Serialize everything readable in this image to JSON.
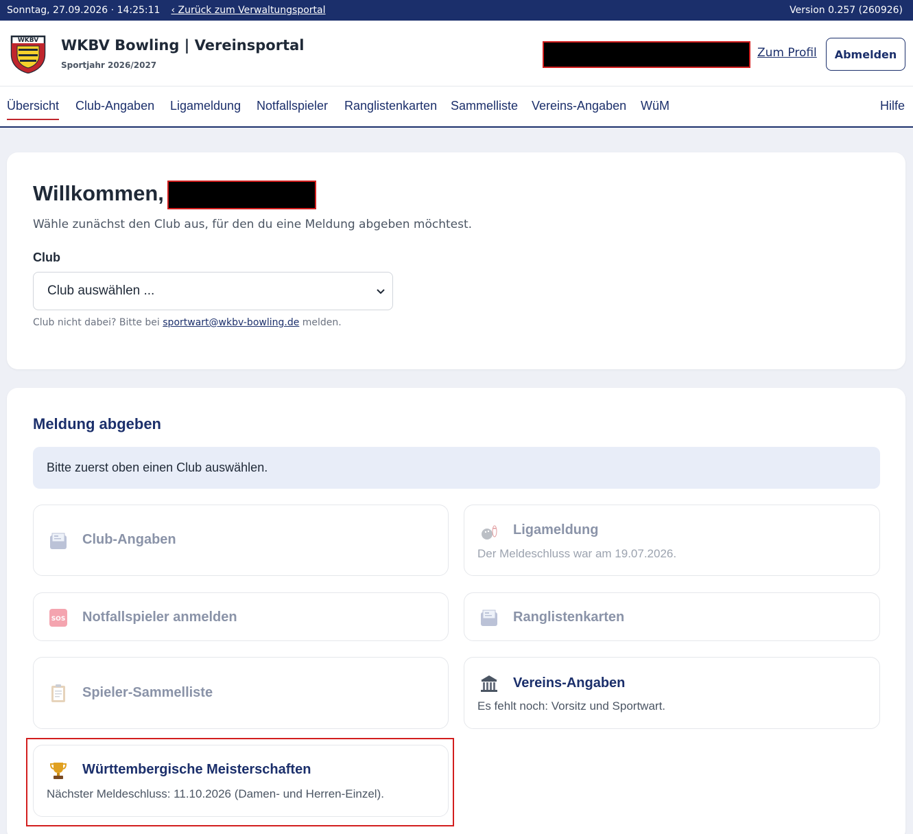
{
  "topbar": {
    "datetime": "Sonntag, 27.09.2026 · 14:25:11",
    "back_link": "‹ Zurück zum Verwaltungsportal",
    "version": "Version 0.257 (260926)"
  },
  "header": {
    "logo_text": "WKBV",
    "title": "WKBV Bowling | Vereinsportal",
    "subtitle": "Sportjahr 2026/2027",
    "profile_link": "Zum Profil",
    "logout_label": "Abmelden"
  },
  "nav": {
    "items": [
      {
        "label": "Übersicht",
        "active": true
      },
      {
        "label": "Club-Angaben"
      },
      {
        "label": "Ligameldung"
      },
      {
        "label": "Notfallspieler"
      },
      {
        "label": "Ranglistenkarten"
      },
      {
        "label": "Sammelliste"
      },
      {
        "label": "Vereins-Angaben"
      },
      {
        "label": "WüM"
      }
    ],
    "help": "Hilfe"
  },
  "welcome": {
    "title": "Willkommen,",
    "subtitle": "Wähle zunächst den Club aus, für den du eine Meldung abgeben möchtest.",
    "club_label": "Club",
    "club_select_value": "Club auswählen ...",
    "hint_before": "Club nicht dabei? Bitte bei ",
    "hint_email": "sportwart@wkbv-bowling.de",
    "hint_after": " melden."
  },
  "meldung": {
    "title": "Meldung abgeben",
    "info": "Bitte zuerst oben einen Club auswählen.",
    "tiles": [
      {
        "title": "Club-Angaben",
        "desc": "",
        "icon": "calendar-icon",
        "state": "disabled"
      },
      {
        "title": "Ligameldung",
        "desc": "Der Meldeschluss war am 19.07.2026.",
        "icon": "bowling-icon",
        "state": "disabled"
      },
      {
        "title": "Notfallspieler anmelden",
        "desc": "",
        "icon": "sos-icon",
        "state": "disabled"
      },
      {
        "title": "Ranglistenkarten",
        "desc": "",
        "icon": "calendar-icon",
        "state": "disabled"
      },
      {
        "title": "Spieler-Sammelliste",
        "desc": "",
        "icon": "clipboard-icon",
        "state": "disabled"
      },
      {
        "title": "Vereins-Angaben",
        "desc": "Es fehlt noch: Vorsitz und Sportwart.",
        "icon": "building-icon",
        "state": "enabled"
      },
      {
        "title": "Württembergische Meisterschaften",
        "desc": "Nächster Meldeschluss: 11.10.2026 (Damen- und Herren-Einzel).",
        "icon": "trophy-icon",
        "state": "enabled"
      }
    ]
  },
  "colors": {
    "primary": "#1b2f6b",
    "accent_red": "#c0262d",
    "background": "#eef0f6",
    "info_bg": "#e8edf8"
  }
}
